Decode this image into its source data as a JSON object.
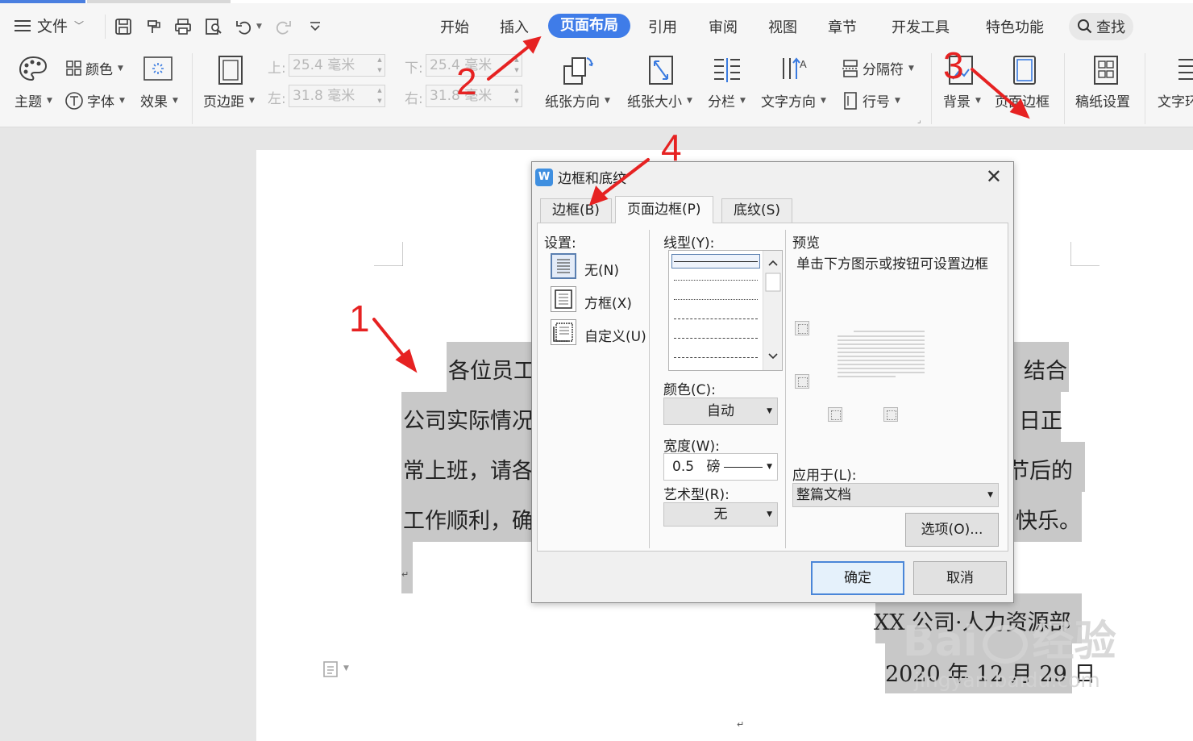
{
  "menubar": {
    "file_label": "文件",
    "tabs": [
      "开始",
      "插入",
      "页面布局",
      "引用",
      "审阅",
      "视图",
      "章节",
      "开发工具",
      "特色功能"
    ],
    "active_tab": "页面布局",
    "search_label": "查找"
  },
  "ribbon": {
    "theme": "主题",
    "color": "颜色",
    "font": "字体",
    "effect": "效果",
    "margins": "页边距",
    "top_label": "上:",
    "top_value": "25.4 毫米",
    "left_label": "左:",
    "left_value": "31.8 毫米",
    "bottom_label": "下:",
    "bottom_value": "25.4 毫米",
    "right_label": "右:",
    "right_value": "31.8 毫米",
    "orientation": "纸张方向",
    "size": "纸张大小",
    "columns": "分栏",
    "text_direction": "文字方向",
    "breaks": "分隔符",
    "line_numbers": "行号",
    "background": "背景",
    "page_borders": "页面边框",
    "manuscript": "稿纸设置",
    "text_wrap": "文字环"
  },
  "document": {
    "line1_left": "各位员工",
    "line1_right": "结合",
    "line2_left": "公司实际情况",
    "line2_right": "日正",
    "line3_left": "常上班，请各",
    "line3_right": "节后的",
    "line4_left": "工作顺利，确",
    "line4_right": "快乐。",
    "signature": "XX 公司·人力资源部",
    "date": "2020 年 12 月 29 日",
    "para_mark": "↵"
  },
  "dialog": {
    "title": "边框和底纹",
    "tabs": [
      "边框(B)",
      "页面边框(P)",
      "底纹(S)"
    ],
    "active_tab": "页面边框(P)",
    "settings_label": "设置:",
    "setting_none": "无(N)",
    "setting_box": "方框(X)",
    "setting_custom": "自定义(U)",
    "line_style_label": "线型(Y):",
    "color_label": "颜色(C):",
    "color_value": "自动",
    "width_label": "宽度(W):",
    "width_value": "0.5",
    "width_unit": "磅",
    "art_label": "艺术型(R):",
    "art_value": "无",
    "preview_label": "预览",
    "preview_hint": "单击下方图示或按钮可设置边框",
    "apply_label": "应用于(L):",
    "apply_value": "整篇文档",
    "options_button": "选项(O)...",
    "ok_button": "确定",
    "cancel_button": "取消"
  },
  "annotations": {
    "n1": "1",
    "n2": "2",
    "n3": "3",
    "n4": "4",
    "color": "#e62222"
  },
  "watermark": {
    "brand": "Bai",
    "brand2": "经验",
    "url": "jingyan.baidu.com"
  }
}
